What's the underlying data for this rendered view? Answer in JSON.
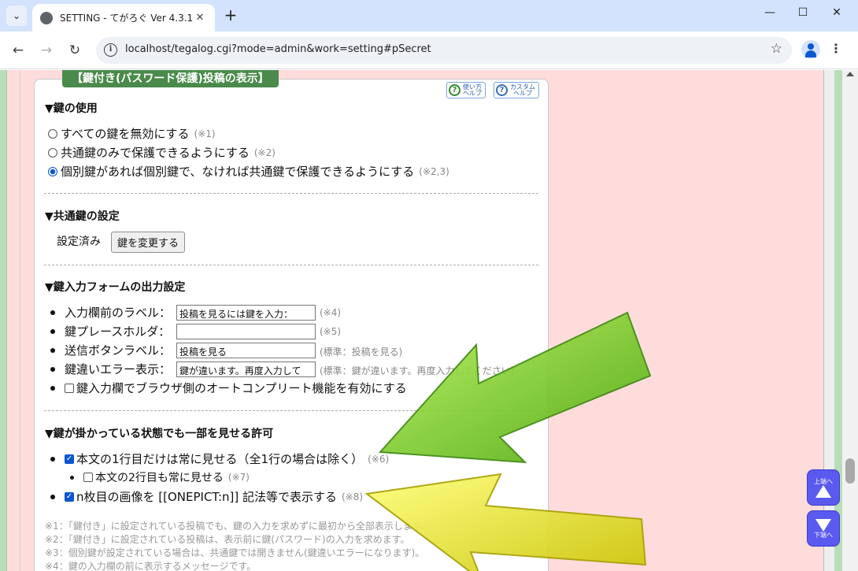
{
  "browser": {
    "tab_title": "SETTING - てがろぐ Ver 4.3.1",
    "new_tab": "+",
    "url": "localhost/tegalog.cgi?mode=admin&work=setting#pSecret"
  },
  "panel": {
    "title": "【鍵付き(パスワード保護)投稿の表示】",
    "help1": [
      "使い方",
      "ヘルプ"
    ],
    "help2": [
      "カスタム",
      "ヘルプ"
    ]
  },
  "sec1": {
    "heading": "▼鍵の使用",
    "options": [
      {
        "label": "すべての鍵を無効にする",
        "note": "(※1)",
        "selected": false
      },
      {
        "label": "共通鍵のみで保護できるようにする",
        "note": "(※2)",
        "selected": false
      },
      {
        "label": "個別鍵があれば個別鍵で、なければ共通鍵で保護できるようにする",
        "note": "(※2,3)",
        "selected": true
      }
    ]
  },
  "sec2": {
    "heading": "▼共通鍵の設定",
    "status": "設定済み",
    "button": "鍵を変更する"
  },
  "sec3": {
    "heading": "▼鍵入力フォームの出力設定",
    "rows": [
      {
        "label": "入力欄前のラベル：",
        "value": "投稿を見るには鍵を入力：",
        "note": "(※4)"
      },
      {
        "label": "鍵プレースホルダ：",
        "value": "",
        "note": "(※5)"
      },
      {
        "label": "送信ボタンラベル：",
        "value": "投稿を見る",
        "note": "(標準：投稿を見る)"
      },
      {
        "label": "鍵違いエラー表示：",
        "value": "鍵が違います。再度入力して",
        "note": "(標準：鍵が違います。再度入力してください)"
      }
    ],
    "autocomplete": {
      "label": "鍵入力欄でブラウザ側のオートコンプリート機能を有効にする",
      "checked": false
    }
  },
  "sec4": {
    "heading": "▼鍵が掛かっている状態でも一部を見せる許可",
    "items": [
      {
        "label": "本文の1行目だけは常に見せる（全1行の場合は除く）",
        "note": "(※6)",
        "checked": true
      },
      {
        "label": "本文の2行目も常に見せる",
        "note": "(※7)",
        "checked": false
      },
      {
        "label": "n枚目の画像を [[ONEPICT:n]] 記法等で表示する",
        "note": "(※8)",
        "checked": true
      }
    ]
  },
  "footnotes": [
    "※1：「鍵付き」に設定されている投稿でも、鍵の入力を求めずに最初から全部表示します。",
    "※2：「鍵付き」に設定されている投稿は、表示前に鍵(パスワード)の入力を求めます。",
    "※3：個別鍵が設定されている場合は、共通鍵では開きません(鍵違いエラーになります)。",
    "※4：鍵の入力欄の前に表示するメッセージです。"
  ],
  "nav": {
    "top": "上端へ",
    "bottom": "下端へ"
  },
  "colors": {
    "panel_title_bg": "#4a8a4a",
    "page_bg": "#ffdcdc",
    "nav_btn": "#5a5af0",
    "arrow_green": "#66cc11",
    "arrow_yellow": "#eeee22"
  }
}
